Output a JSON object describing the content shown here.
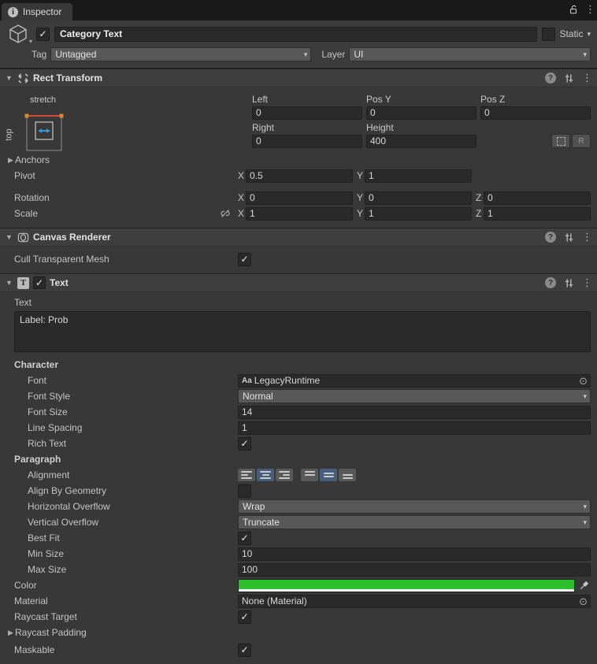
{
  "icons": {
    "check": "✓",
    "dropdown": "▾",
    "foldout_open": "▼",
    "foldout_closed": "▶",
    "kebab": "⋮",
    "help": "?",
    "info": "i",
    "object_picker": "⊙",
    "aa": "Aa"
  },
  "colors": {
    "text_color_swatch": "#2BC02B",
    "selected_align_button": "#46607C"
  },
  "window": {
    "tab_label": "Inspector"
  },
  "gameobject": {
    "name": "Category Text",
    "active": true,
    "static_label": "Static",
    "tag_label": "Tag",
    "tag_value": "Untagged",
    "layer_label": "Layer",
    "layer_value": "UI"
  },
  "rect_transform": {
    "title": "Rect Transform",
    "anchor_preset": {
      "horizontal_label": "stretch",
      "vertical_label": "top"
    },
    "left_label": "Left",
    "left_value": "0",
    "posy_label": "Pos Y",
    "posy_value": "0",
    "posz_label": "Pos Z",
    "posz_value": "0",
    "right_label": "Right",
    "right_value": "0",
    "height_label": "Height",
    "height_value": "400",
    "r_button_label": "R",
    "anchors_label": "Anchors",
    "pivot_label": "Pivot",
    "pivot_x_label": "X",
    "pivot_x": "0.5",
    "pivot_y_label": "Y",
    "pivot_y": "1",
    "rotation_label": "Rotation",
    "rot_x_label": "X",
    "rot_x": "0",
    "rot_y_label": "Y",
    "rot_y": "0",
    "rot_z_label": "Z",
    "rot_z": "0",
    "scale_label": "Scale",
    "scale_x_label": "X",
    "scale_x": "1",
    "scale_y_label": "Y",
    "scale_y": "1",
    "scale_z_label": "Z",
    "scale_z": "1"
  },
  "canvas_renderer": {
    "title": "Canvas Renderer",
    "cull_label": "Cull Transparent Mesh",
    "cull_checked": true
  },
  "text_component": {
    "title": "Text",
    "text_label": "Text",
    "text_value": "Label: Prob",
    "character_label": "Character",
    "font_label": "Font",
    "font_value": "LegacyRuntime",
    "font_style_label": "Font Style",
    "font_style_value": "Normal",
    "font_size_label": "Font Size",
    "font_size_value": "14",
    "line_spacing_label": "Line Spacing",
    "line_spacing_value": "1",
    "rich_text_label": "Rich Text",
    "paragraph_label": "Paragraph",
    "alignment_label": "Alignment",
    "align_by_geometry_label": "Align By Geometry",
    "horizontal_overflow_label": "Horizontal Overflow",
    "horizontal_overflow_value": "Wrap",
    "vertical_overflow_label": "Vertical Overflow",
    "vertical_overflow_value": "Truncate",
    "best_fit_label": "Best Fit",
    "min_size_label": "Min Size",
    "min_size_value": "10",
    "max_size_label": "Max Size",
    "max_size_value": "100",
    "color_label": "Color",
    "material_label": "Material",
    "material_value": "None (Material)",
    "raycast_target_label": "Raycast Target",
    "raycast_padding_label": "Raycast Padding",
    "maskable_label": "Maskable"
  }
}
